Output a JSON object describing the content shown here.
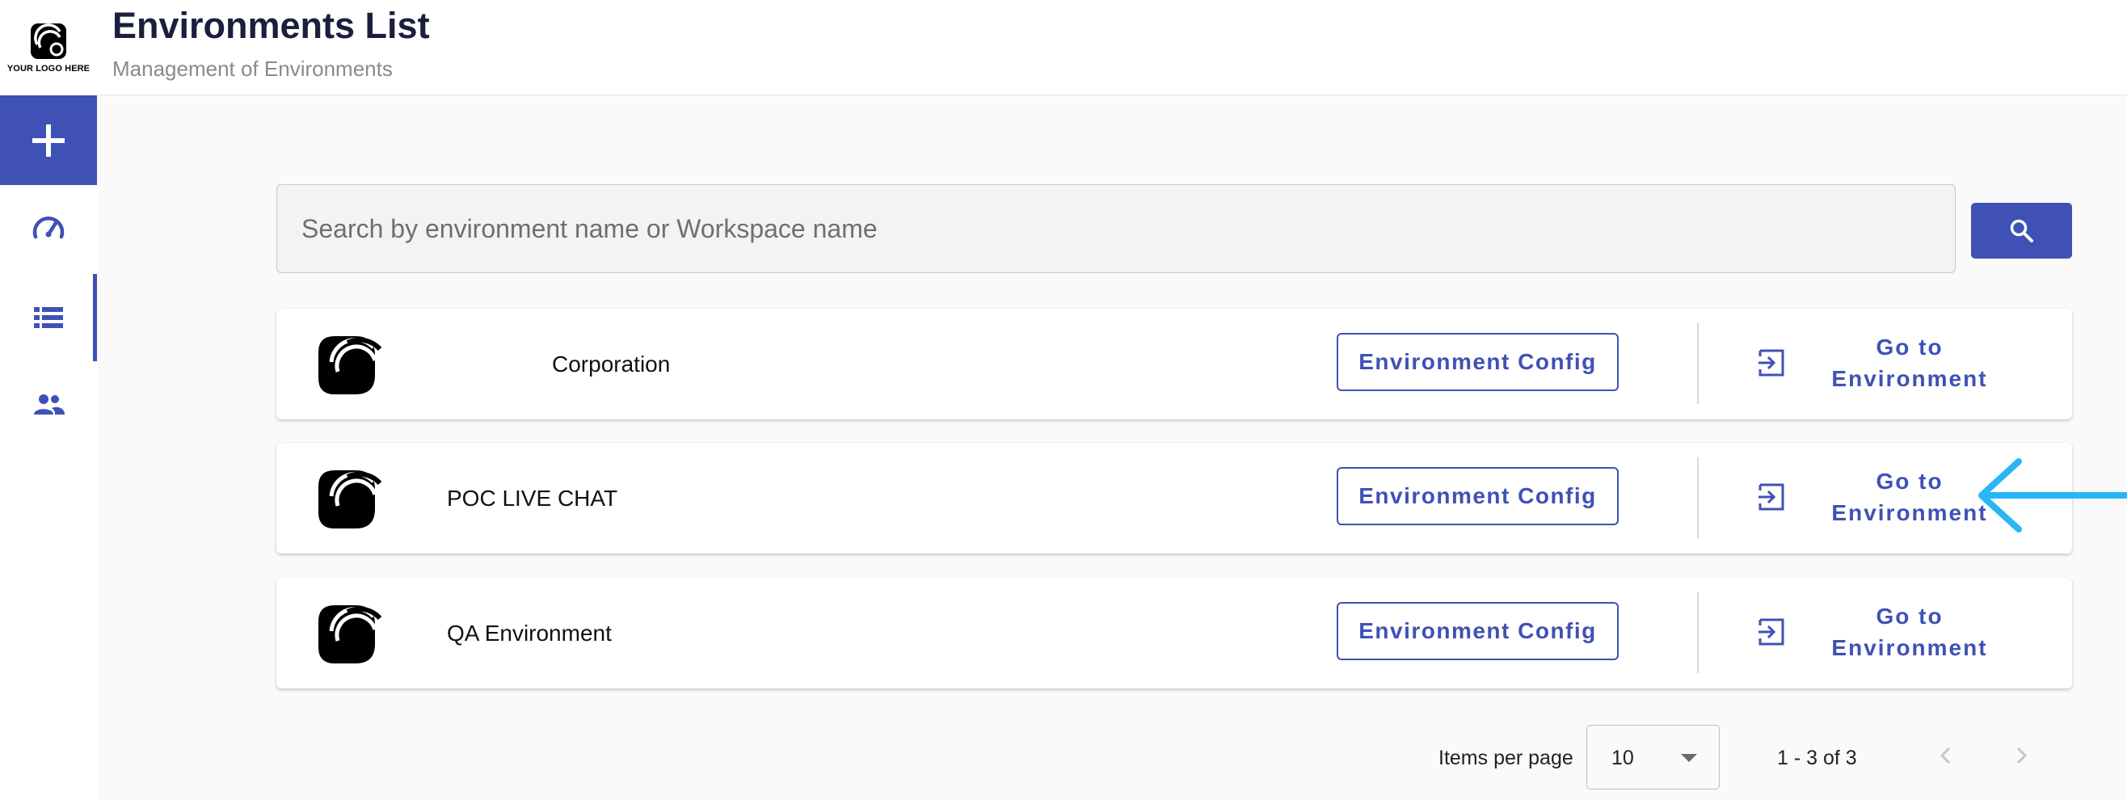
{
  "brand": {
    "logo_text": "YOUR LOGO HERE"
  },
  "header": {
    "title": "Environments List",
    "subtitle": "Management of Environments"
  },
  "rail": {
    "items": [
      {
        "icon": "plus-icon",
        "action": "add"
      },
      {
        "icon": "speedometer-icon"
      },
      {
        "icon": "list-icon",
        "active": true
      },
      {
        "icon": "people-icon"
      }
    ]
  },
  "search": {
    "placeholder": "Search by environment name or Workspace name",
    "value": "",
    "button_icon": "search-icon"
  },
  "environments": [
    {
      "name": "Corporation",
      "config_label": "Environment Config",
      "goto_label": "Go to\nEnvironment"
    },
    {
      "name": "POC LIVE CHAT",
      "config_label": "Environment Config",
      "goto_label": "Go to\nEnvironment"
    },
    {
      "name": "QA Environment",
      "config_label": "Environment Config",
      "goto_label": "Go to\nEnvironment"
    }
  ],
  "paginator": {
    "items_per_page_label": "Items per page",
    "page_size": "10",
    "range_label": "1 - 3 of 3"
  },
  "colors": {
    "primary": "#3f51b5",
    "header_title": "#1b1e3d",
    "annotation_arrow": "#29b6f6",
    "background": "#fafafa"
  }
}
